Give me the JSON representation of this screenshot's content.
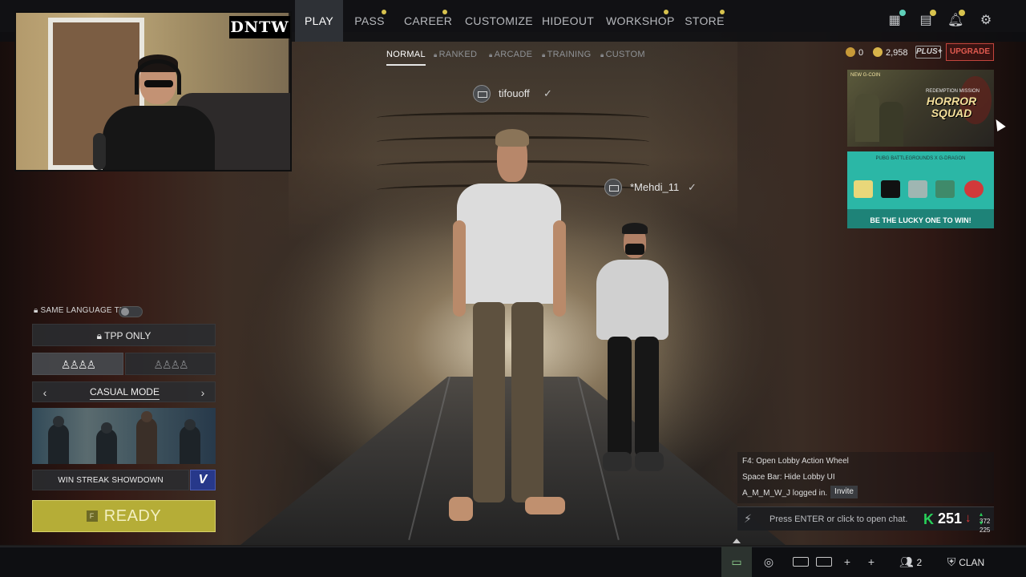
{
  "webcam": {
    "overlay_logo": "DNTW"
  },
  "nav": {
    "items": [
      {
        "label": "PLAY",
        "active": true,
        "dot": false
      },
      {
        "label": "PASS",
        "active": false,
        "dot": true
      },
      {
        "label": "CAREER",
        "active": false,
        "dot": true
      },
      {
        "label": "CUSTOMIZE",
        "active": false,
        "dot": false
      },
      {
        "label": "HIDEOUT",
        "active": false,
        "dot": false
      },
      {
        "label": "WORKSHOP",
        "active": false,
        "dot": true
      },
      {
        "label": "STORE",
        "active": false,
        "dot": true
      }
    ],
    "right_icons": [
      "shop-icon",
      "news-icon",
      "bell-icon",
      "gear-icon"
    ]
  },
  "modes": {
    "items": [
      {
        "label": "NORMAL",
        "active": true,
        "locked": false
      },
      {
        "label": "RANKED",
        "active": false,
        "locked": true
      },
      {
        "label": "ARCADE",
        "active": false,
        "locked": true
      },
      {
        "label": "TRAINING",
        "active": false,
        "locked": true
      },
      {
        "label": "CUSTOM",
        "active": false,
        "locked": true
      }
    ]
  },
  "currency": {
    "gcoin": "0",
    "bp": "2,958",
    "plus_label": "PLUS+",
    "upgrade_label": "UPGRADE"
  },
  "banners": {
    "banner1": {
      "tag": "NEW G-COIN",
      "subtitle": "REDEMPTION MISSION",
      "title": "HORROR SQUAD"
    },
    "banner2": {
      "header": "PUBG BATTLEGROUNDS X G-DRAGON",
      "cta": "BE THE LUCKY ONE TO WIN!"
    }
  },
  "players": [
    {
      "name": "tifouoff",
      "ready": true
    },
    {
      "name": "*Mehdi_11",
      "ready": true
    }
  ],
  "lobby": {
    "same_language_label": "SAME LANGUAGE TEAM",
    "tpp_label": "TPP ONLY",
    "squad_icons_left": "♙♙♙♙",
    "squad_icons_right": "♙♙♙♙",
    "mode_prev": "‹",
    "mode_label": "CASUAL MODE",
    "mode_next": "›",
    "event_label": "WIN STREAK SHOWDOWN",
    "event_badge": "V",
    "ready_key": "F",
    "ready_label": "READY"
  },
  "chat": {
    "lines": [
      "F4: Open Lobby Action Wheel",
      "Space Bar: Hide Lobby UI",
      "A_M_M_W_J logged in."
    ],
    "invite_label": "Invite",
    "input_placeholder": "Press ENTER or click to open chat.",
    "ping_value": "251",
    "ping_up": "372",
    "ping_down": "225"
  },
  "bottom": {
    "plus1": "+",
    "plus2": "+",
    "friends_count": "2",
    "clan_label": "CLAN"
  }
}
